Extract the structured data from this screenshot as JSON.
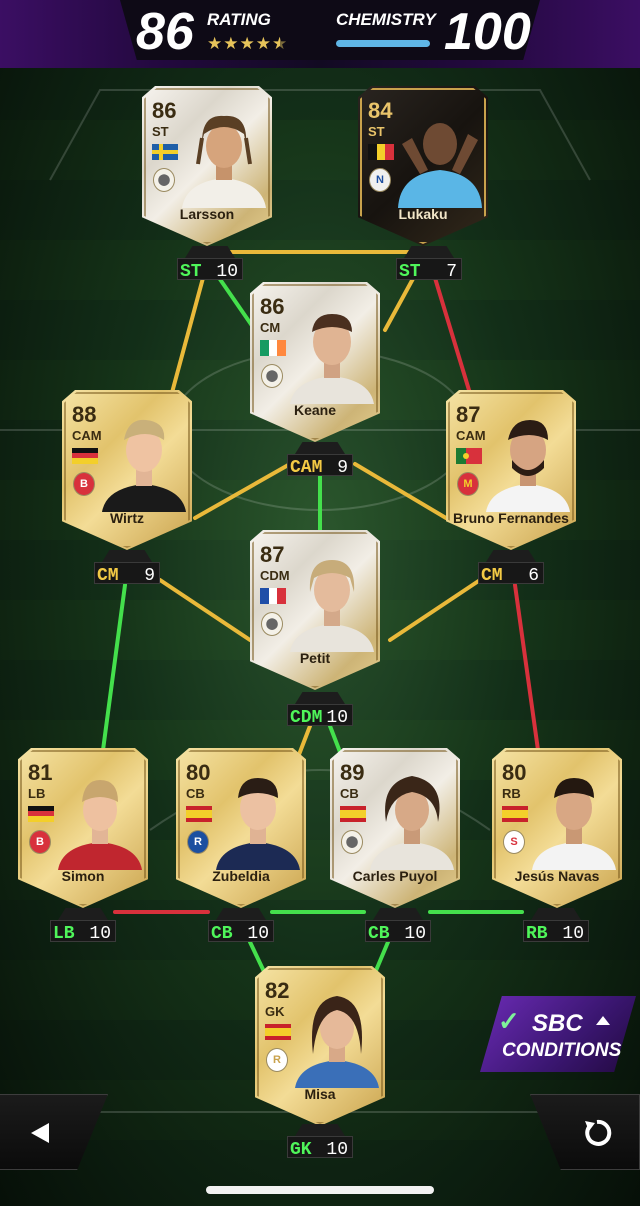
{
  "header": {
    "rating_value": "86",
    "rating_label": "RATING",
    "rating_stars": 4.5,
    "chemistry_label": "CHEMISTRY",
    "chemistry_value": "100"
  },
  "players": [
    {
      "name": "Larsson",
      "rating": "86",
      "position": "ST",
      "style": "icon",
      "flag": "sweden",
      "slot_pos": "ST",
      "chem": "10",
      "chem_color": "green"
    },
    {
      "name": "Lukaku",
      "rating": "84",
      "position": "ST",
      "style": "tots",
      "flag": "belgium",
      "slot_pos": "ST",
      "chem": "7",
      "chem_color": "green"
    },
    {
      "name": "Keane",
      "rating": "86",
      "position": "CM",
      "style": "icon",
      "flag": "ireland",
      "slot_pos": "CAM",
      "chem": "9",
      "chem_color": "yellow"
    },
    {
      "name": "Wirtz",
      "rating": "88",
      "position": "CAM",
      "style": "gold",
      "flag": "germany",
      "slot_pos": "CM",
      "chem": "9",
      "chem_color": "yellow"
    },
    {
      "name": "Bruno Fernandes",
      "rating": "87",
      "position": "CAM",
      "style": "gold",
      "flag": "portugal",
      "slot_pos": "CM",
      "chem": "6",
      "chem_color": "yellow"
    },
    {
      "name": "Petit",
      "rating": "87",
      "position": "CDM",
      "style": "icon",
      "flag": "france",
      "slot_pos": "CDM",
      "chem": "10",
      "chem_color": "green"
    },
    {
      "name": "Simon",
      "rating": "81",
      "position": "LB",
      "style": "gold",
      "flag": "germany",
      "slot_pos": "LB",
      "chem": "10",
      "chem_color": "green"
    },
    {
      "name": "Zubeldia",
      "rating": "80",
      "position": "CB",
      "style": "gold",
      "flag": "spain",
      "slot_pos": "CB",
      "chem": "10",
      "chem_color": "green"
    },
    {
      "name": "Carles Puyol",
      "rating": "89",
      "position": "CB",
      "style": "icon",
      "flag": "spain",
      "slot_pos": "CB",
      "chem": "10",
      "chem_color": "green"
    },
    {
      "name": "Jesús Navas",
      "rating": "80",
      "position": "RB",
      "style": "gold",
      "flag": "spain",
      "slot_pos": "RB",
      "chem": "10",
      "chem_color": "green"
    },
    {
      "name": "Misa",
      "rating": "82",
      "position": "GK",
      "style": "gold",
      "flag": "spain",
      "slot_pos": "GK",
      "chem": "10",
      "chem_color": "green"
    }
  ],
  "links_colors": {
    "green": "#44e04c",
    "yellow": "#e9b93a",
    "red": "#d8313c"
  },
  "sbc": {
    "line1": "SBC",
    "line2": "CONDITIONS"
  },
  "nav": {
    "back_icon": "triangle-left-icon",
    "reset_icon": "rotate-icon"
  },
  "accent": {
    "purple": "#4b1582",
    "gold": "#e6c35a",
    "chem_bar": "#5fb6e6"
  }
}
